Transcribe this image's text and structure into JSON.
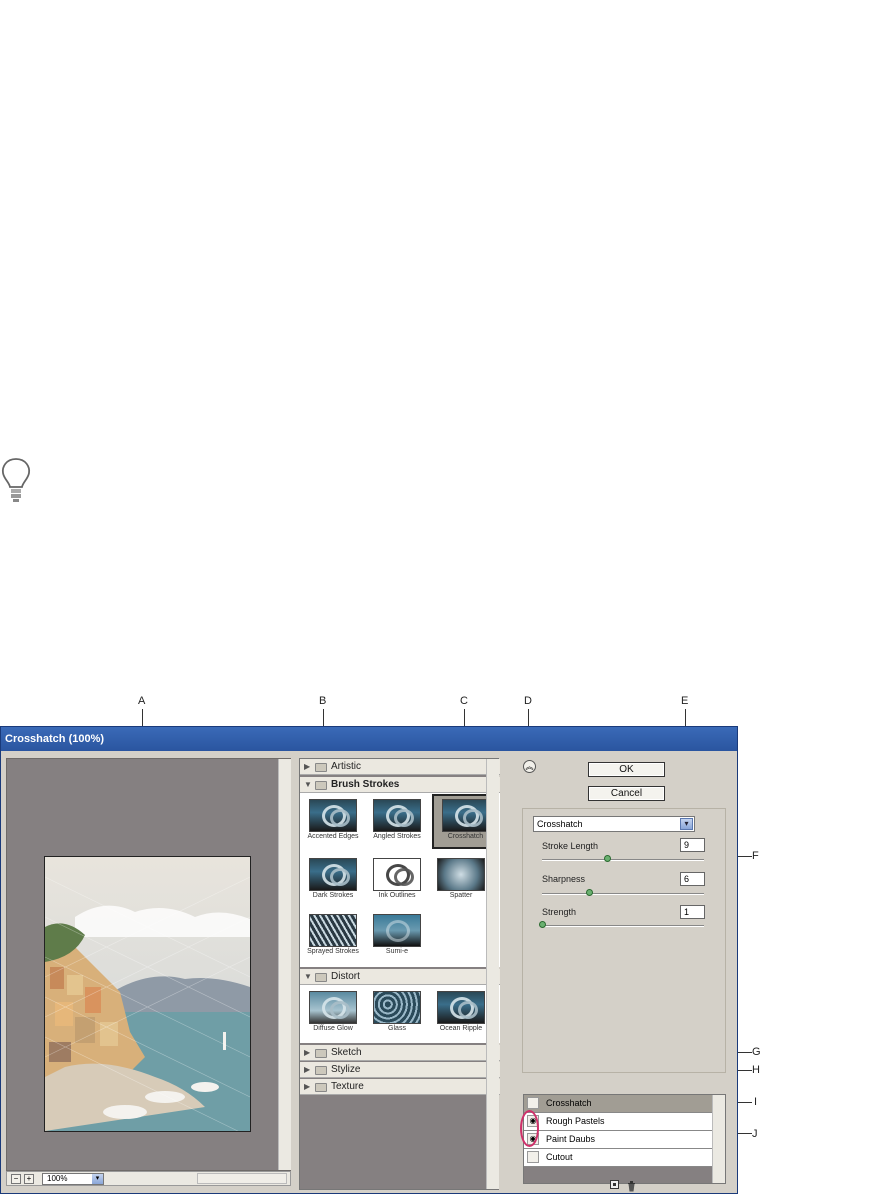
{
  "callouts": [
    "A",
    "B",
    "C",
    "D",
    "E",
    "F",
    "G",
    "H",
    "I",
    "J"
  ],
  "window": {
    "title": "Crosshatch (100%)",
    "zoom": {
      "value": "100%",
      "minus_icon": "minus-icon",
      "plus_icon": "plus-icon"
    },
    "gallery": {
      "categories": [
        {
          "label": "Artistic",
          "expanded": false
        },
        {
          "label": "Brush Strokes",
          "expanded": true,
          "filters": [
            "Accented Edges",
            "Angled Strokes",
            "Crosshatch",
            "Dark Strokes",
            "Ink Outlines",
            "Spatter",
            "Sprayed Strokes",
            "Sumi-e"
          ],
          "selected": "Crosshatch"
        },
        {
          "label": "Distort",
          "expanded": true,
          "filters": [
            "Diffuse Glow",
            "Glass",
            "Ocean Ripple"
          ]
        },
        {
          "label": "Sketch",
          "expanded": false
        },
        {
          "label": "Stylize",
          "expanded": false
        },
        {
          "label": "Texture",
          "expanded": false
        }
      ]
    },
    "buttons": {
      "ok": "OK",
      "cancel": "Cancel"
    },
    "filter_menu": {
      "value": "Crosshatch"
    },
    "params": [
      {
        "label": "Stroke Length",
        "value": "9",
        "fraction": 0.42
      },
      {
        "label": "Sharpness",
        "value": "6",
        "fraction": 0.3
      },
      {
        "label": "Strength",
        "value": "1",
        "fraction": 0.0
      }
    ],
    "layers": [
      {
        "name": "Crosshatch",
        "visible": false,
        "active": true
      },
      {
        "name": "Rough Pastels",
        "visible": true,
        "active": false
      },
      {
        "name": "Paint Daubs",
        "visible": true,
        "active": false
      },
      {
        "name": "Cutout",
        "visible": false,
        "active": false
      }
    ],
    "icons": {
      "collapse": "collapse-chevrons-icon",
      "new_layer": "new-layer-icon",
      "delete_layer": "trash-icon"
    }
  }
}
